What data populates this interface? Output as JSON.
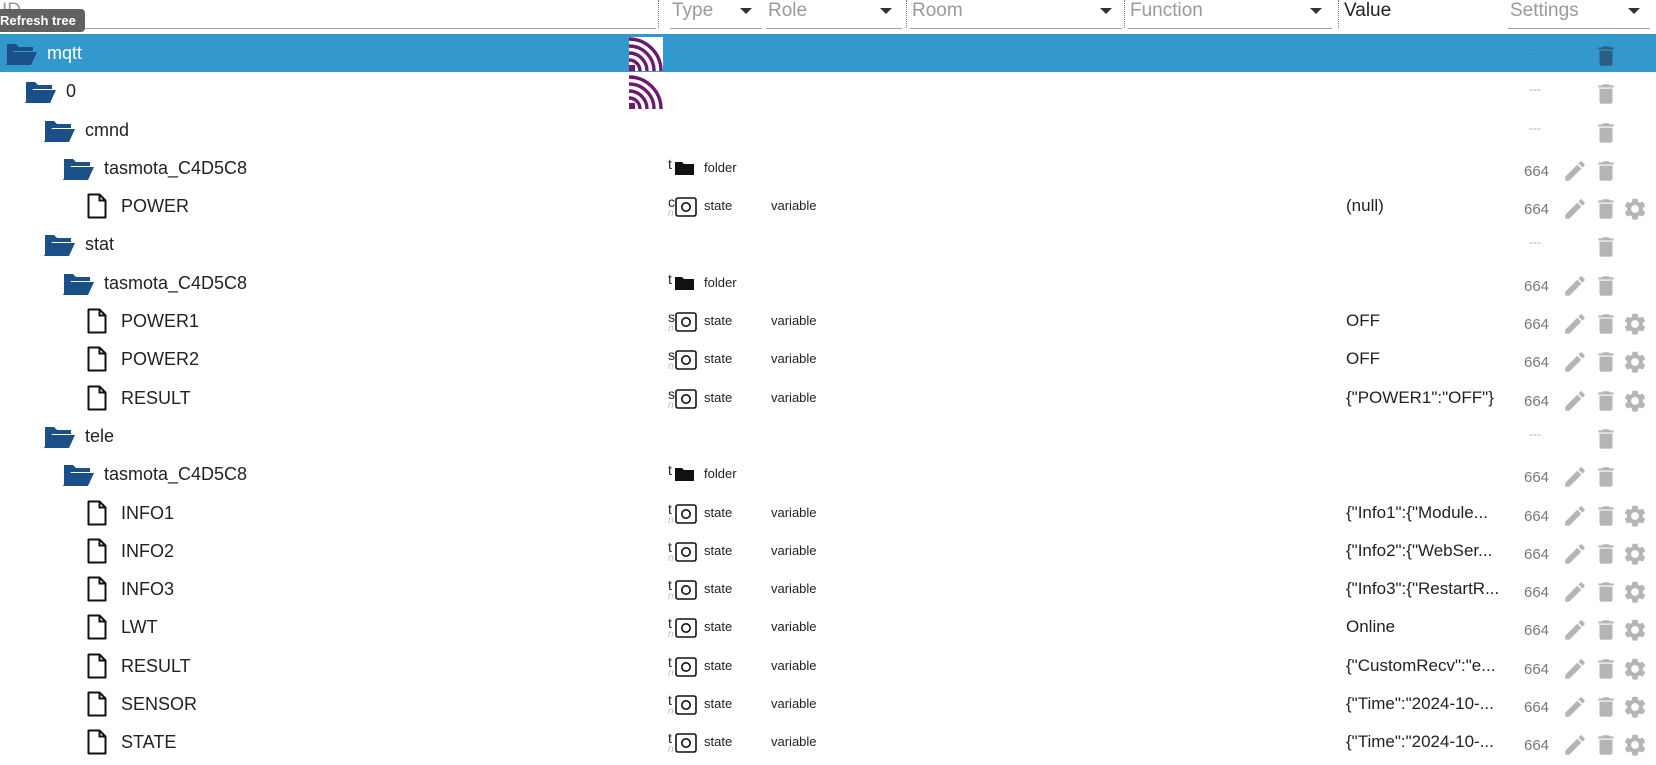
{
  "header": {
    "id_placeholder": "ID",
    "type_placeholder": "Type",
    "role_placeholder": "Role",
    "room_placeholder": "Room",
    "function_placeholder": "Function",
    "value_label": "Value",
    "settings_placeholder": "Settings",
    "tooltip": "Refresh tree"
  },
  "colors": {
    "selected_row": "#3399cc",
    "folder": "#1a4f87",
    "logo": "#6b1a6e"
  },
  "rows": [
    {
      "name": "mqtt",
      "icon": "folder-open-icon",
      "type_abbr": "",
      "type": "",
      "role": "",
      "value": "",
      "acl": "---",
      "selected": true
    },
    {
      "name": "0",
      "icon": "folder-open-icon",
      "type_abbr": "",
      "type": "",
      "role": "",
      "value": "",
      "acl": "---"
    },
    {
      "name": "cmnd",
      "icon": "folder-open-icon",
      "type_abbr": "",
      "type": "",
      "role": "",
      "value": "",
      "acl": "---"
    },
    {
      "name": "tasmota_C4D5C8",
      "icon": "folder-open-icon",
      "type_abbr": "t",
      "type": "folder",
      "role": "",
      "value": "",
      "acl": "664"
    },
    {
      "name": "POWER",
      "icon": "file-icon",
      "type_abbr": "c",
      "type_abbr2": "n",
      "type": "state",
      "role": "variable",
      "value": "(null)",
      "acl": "664"
    },
    {
      "name": "stat",
      "icon": "folder-open-icon",
      "type_abbr": "",
      "type": "",
      "role": "",
      "value": "",
      "acl": "---"
    },
    {
      "name": "tasmota_C4D5C8",
      "icon": "folder-open-icon",
      "type_abbr": "t",
      "type": "folder",
      "role": "",
      "value": "",
      "acl": "664"
    },
    {
      "name": "POWER1",
      "icon": "file-icon",
      "type_abbr": "s",
      "type_abbr2": "n",
      "type": "state",
      "role": "variable",
      "value": "OFF",
      "acl": "664"
    },
    {
      "name": "POWER2",
      "icon": "file-icon",
      "type_abbr": "s",
      "type_abbr2": "n",
      "type": "state",
      "role": "variable",
      "value": "OFF",
      "acl": "664"
    },
    {
      "name": "RESULT",
      "icon": "file-icon",
      "type_abbr": "s",
      "type_abbr2": "n",
      "type": "state",
      "role": "variable",
      "value": "{\"POWER1\":\"OFF\"}",
      "acl": "664"
    },
    {
      "name": "tele",
      "icon": "folder-open-icon",
      "type_abbr": "",
      "type": "",
      "role": "",
      "value": "",
      "acl": "---"
    },
    {
      "name": "tasmota_C4D5C8",
      "icon": "folder-open-icon",
      "type_abbr": "t",
      "type": "folder",
      "role": "",
      "value": "",
      "acl": "664"
    },
    {
      "name": "INFO1",
      "icon": "file-icon",
      "type_abbr": "t",
      "type_abbr2": "n",
      "type": "state",
      "role": "variable",
      "value": "{\"Info1\":{\"Module...",
      "acl": "664"
    },
    {
      "name": "INFO2",
      "icon": "file-icon",
      "type_abbr": "t",
      "type_abbr2": "n",
      "type": "state",
      "role": "variable",
      "value": "{\"Info2\":{\"WebSer...",
      "acl": "664"
    },
    {
      "name": "INFO3",
      "icon": "file-icon",
      "type_abbr": "t",
      "type_abbr2": "n",
      "type": "state",
      "role": "variable",
      "value": "{\"Info3\":{\"RestartR...",
      "acl": "664"
    },
    {
      "name": "LWT",
      "icon": "file-icon",
      "type_abbr": "t",
      "type_abbr2": "n",
      "type": "state",
      "role": "variable",
      "value": "Online",
      "acl": "664"
    },
    {
      "name": "RESULT",
      "icon": "file-icon",
      "type_abbr": "t",
      "type_abbr2": "n",
      "type": "state",
      "role": "variable",
      "value": "{\"CustomRecv\":\"e...",
      "acl": "664"
    },
    {
      "name": "SENSOR",
      "icon": "file-icon",
      "type_abbr": "t",
      "type_abbr2": "n",
      "type": "state",
      "role": "variable",
      "value": "{\"Time\":\"2024-10-...",
      "acl": "664"
    },
    {
      "name": "STATE",
      "icon": "file-icon",
      "type_abbr": "t",
      "type_abbr2": "n",
      "type": "state",
      "role": "variable",
      "value": "{\"Time\":\"2024-10-...",
      "acl": "664"
    }
  ]
}
